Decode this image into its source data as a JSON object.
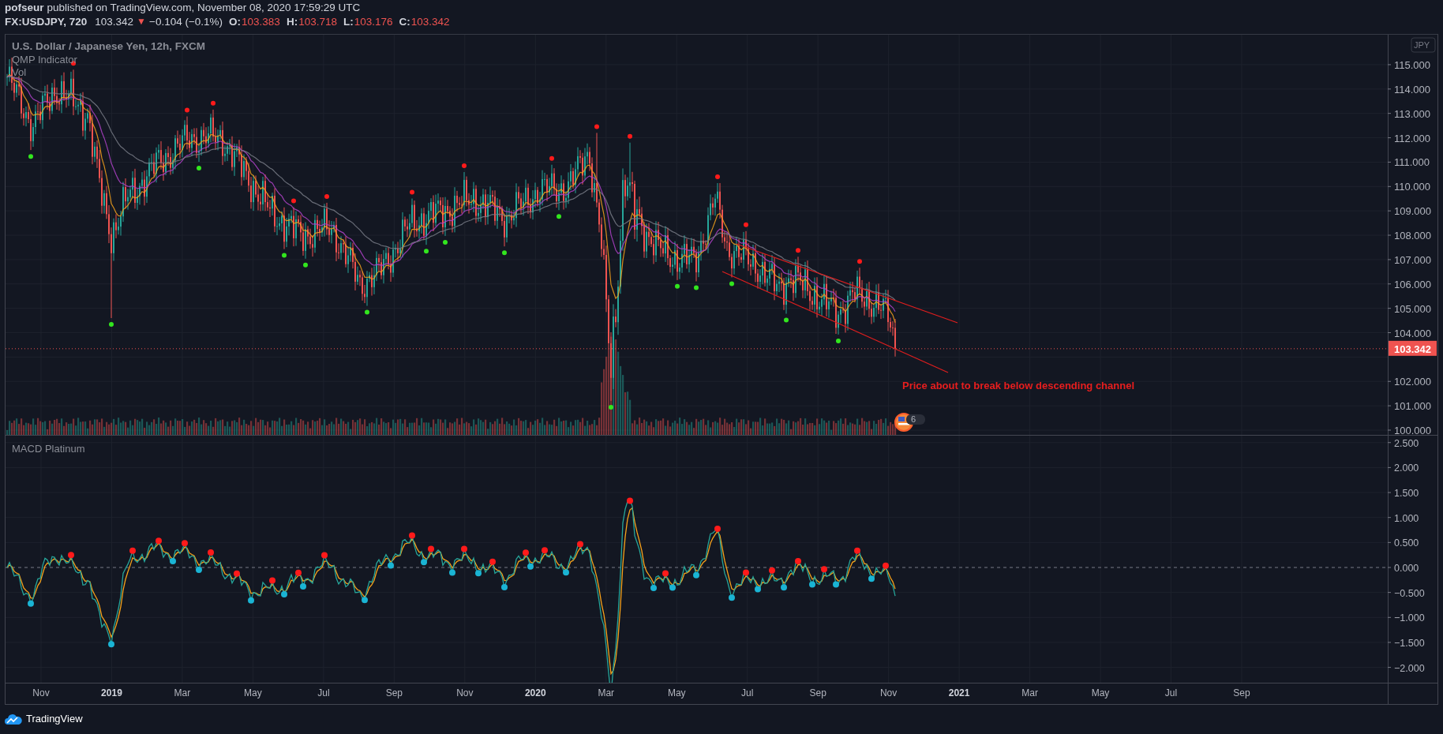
{
  "header": {
    "author": "pofseur",
    "published": "published on TradingView.com, November 08, 2020 17:59:29 UTC"
  },
  "symbol_bar": {
    "symbol": "FX:USDJPY, 720",
    "last": "103.342",
    "change_arrow": "▼",
    "change": "−0.104 (−0.1%)",
    "ohlc": [
      {
        "label": "O:",
        "value": "103.383"
      },
      {
        "label": "H:",
        "value": "103.718"
      },
      {
        "label": "L:",
        "value": "103.176"
      },
      {
        "label": "C:",
        "value": "103.342"
      }
    ]
  },
  "price_pane": {
    "title": "U.S. Dollar / Japanese Yen, 12h, FXCM",
    "indicators": [
      "QMP Indicator",
      "Vol"
    ],
    "currency": "JPY",
    "axis_labels_upper": [
      "115.000",
      "114.000",
      "113.000",
      "112.000",
      "111.000",
      "110.000",
      "109.000",
      "108.000",
      "107.000",
      "106.000",
      "105.000",
      "104.000"
    ],
    "axis_labels_lower": [
      "102.000",
      "101.000",
      "100.000"
    ],
    "last_price": "103.342",
    "annotation": "Price about to break below descending channel",
    "event_badge": {
      "count": "6"
    }
  },
  "macd_pane": {
    "title": "MACD Platinum",
    "axis_labels": [
      "2.500",
      "2.000",
      "1.500",
      "1.000",
      "0.500",
      "0.000",
      "−0.500",
      "−1.000",
      "−1.500",
      "−2.000"
    ]
  },
  "time_axis": {
    "labels": [
      {
        "label": "Nov",
        "major": false
      },
      {
        "label": "2019",
        "major": true
      },
      {
        "label": "Mar",
        "major": false
      },
      {
        "label": "May",
        "major": false
      },
      {
        "label": "Jul",
        "major": false
      },
      {
        "label": "Sep",
        "major": false
      },
      {
        "label": "Nov",
        "major": false
      },
      {
        "label": "2020",
        "major": true
      },
      {
        "label": "Mar",
        "major": false
      },
      {
        "label": "May",
        "major": false
      },
      {
        "label": "Jul",
        "major": false
      },
      {
        "label": "Sep",
        "major": false
      },
      {
        "label": "Nov",
        "major": false
      },
      {
        "label": "2021",
        "major": true
      },
      {
        "label": "Mar",
        "major": false
      },
      {
        "label": "May",
        "major": false
      },
      {
        "label": "Jul",
        "major": false
      },
      {
        "label": "Sep",
        "major": false
      }
    ]
  },
  "footer": {
    "brand": "TradingView"
  }
}
